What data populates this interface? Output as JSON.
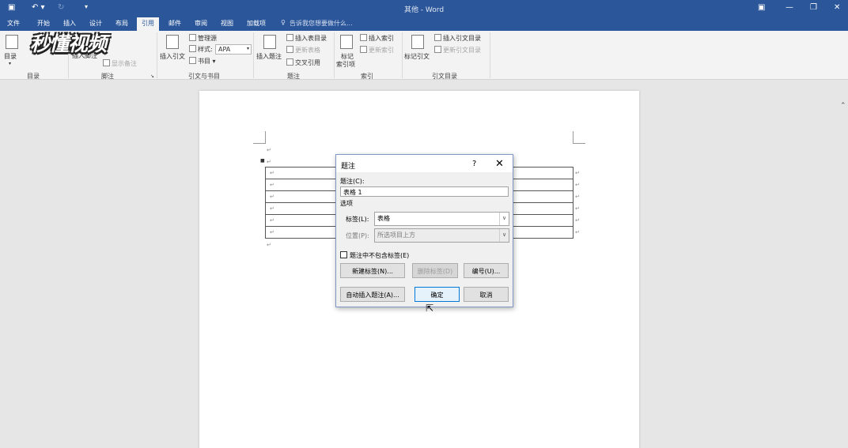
{
  "window": {
    "title": "其他 - Word",
    "quick_access": [
      "save-icon",
      "undo-icon",
      "redo-icon",
      "customize-icon"
    ]
  },
  "tabs": [
    "文件",
    "开始",
    "插入",
    "设计",
    "布局",
    "引用",
    "邮件",
    "审阅",
    "视图",
    "加载项"
  ],
  "active_tab": "引用",
  "tell_me": "告诉我您想要做什么...",
  "watermark": "秒懂视频",
  "ribbon": {
    "toc": {
      "label": "目录",
      "group": "目录"
    },
    "footnote": {
      "insert_footnote": "插入脚注",
      "show_notes": "显示备注",
      "group": "脚注"
    },
    "citations": {
      "insert_citation": "插入引文",
      "manage_sources": "管理源",
      "style_label": "样式:",
      "style_value": "APA",
      "bibliography": "书目",
      "group": "引文与书目"
    },
    "captions": {
      "insert_caption": "插入题注",
      "insert_table_of_figures": "插入表目录",
      "update_table": "更新表格",
      "cross_reference": "交叉引用",
      "group": "题注"
    },
    "index": {
      "mark_entry": "标记",
      "mark_entry2": "索引项",
      "insert_index": "插入索引",
      "update_index": "更新索引",
      "group": "索引"
    },
    "toa": {
      "mark_citation": "标记引文",
      "insert_toa": "插入引文目录",
      "update_toa": "更新引文目录",
      "group": "引文目录"
    }
  },
  "dialog": {
    "title": "题注",
    "help": "?",
    "caption_label": "题注(C):",
    "caption_value": "表格 1",
    "options_label": "选项",
    "label_label": "标签(L):",
    "label_value": "表格",
    "position_label": "位置(P):",
    "position_value": "所选项目上方",
    "exclude_label": "题注中不包含标签(E)",
    "new_label_btn": "新建标签(N)...",
    "delete_label_btn": "删除标签(D)",
    "numbering_btn": "编号(U)...",
    "autocaption_btn": "自动插入题注(A)...",
    "ok_btn": "确定",
    "cancel_btn": "取消"
  }
}
